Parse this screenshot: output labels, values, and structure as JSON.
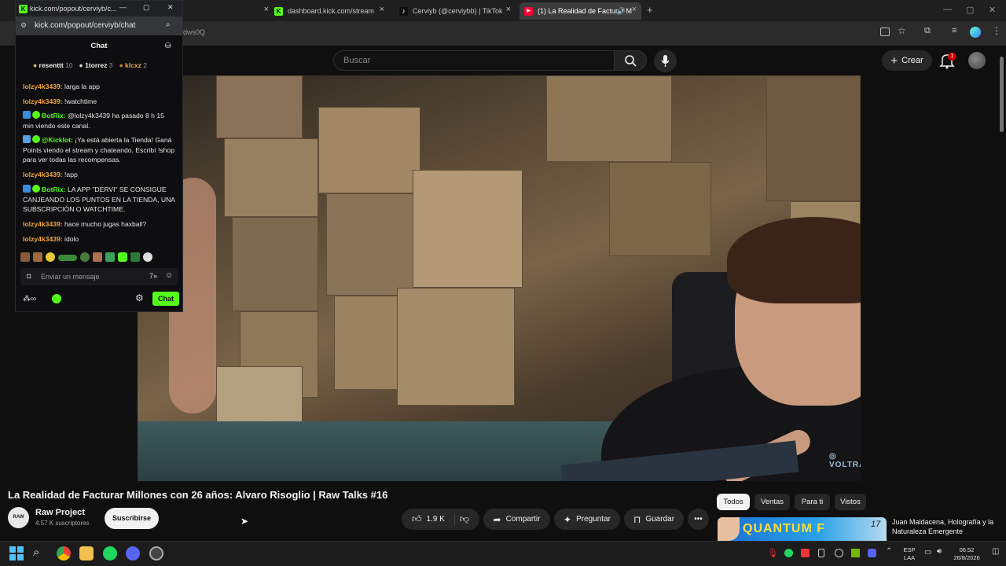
{
  "browser": {
    "tabs": [
      {
        "label": "kick.com/popout/cerviyb/c...",
        "icon": "kick-icon"
      },
      {
        "label": "dashboard.kick.com/stream",
        "icon": "kick-icon"
      },
      {
        "label": "Cerviyb (@cerviybb) | TikTok",
        "icon": "tiktok-icon"
      },
      {
        "label": "(1) La Realidad de Facturar M",
        "icon": "youtube-icon"
      }
    ],
    "new_tab_symbol": "+",
    "address_fragment": "dws0Q"
  },
  "chat_window": {
    "title": "kick.com/popout/cerviyb/c...",
    "url": "kick.com/popout/cerviyb/chat",
    "header": "Chat",
    "leaderboard": [
      {
        "name": "resenttt",
        "count": "10"
      },
      {
        "name": "1torrez",
        "count": "3"
      },
      {
        "name": "klcxz",
        "count": "2"
      }
    ],
    "messages": [
      {
        "user": "lolzy4k3439",
        "text": "larga la app",
        "bot": false
      },
      {
        "user": "lolzy4k3439",
        "text": "!watchtime",
        "bot": false
      },
      {
        "user": "BotRix",
        "text": "@lolzy4k3439 ha pasado 8 h 15 min viendo este canal.",
        "bot": true
      },
      {
        "user": "@Kicklot",
        "text": "¡Ya está abierta la Tienda! Ganá Points viendo el stream y chateando. Escribí !shop para ver todas las recompensas.",
        "bot": true
      },
      {
        "user": "lolzy4k3439",
        "text": "!app",
        "bot": false
      },
      {
        "user": "BotRix",
        "text": "LA APP \"DERVI\" SE CONSIGUE CANJEANDO LOS PUNTOS EN LA TIENDA, UNA SUBSCRIPCIÓN O WATCHTIME.",
        "bot": true
      },
      {
        "user": "lolzy4k3439",
        "text": "hace mucho jugas haxball?",
        "bot": false
      },
      {
        "user": "lolzy4k3439",
        "text": "idolo",
        "bot": false
      }
    ],
    "input_placeholder": "Enviar un mensaje",
    "send_label": "Chat"
  },
  "youtube": {
    "search_placeholder": "Buscar",
    "create_label": "Crear",
    "notif_count": "1",
    "video_title": "La Realidad de Facturar Millones con 26 años: Alvaro Risoglio | Raw Talks #16",
    "channel_name": "Raw Project",
    "channel_avatar_text": "RAW",
    "subscribers": "4.57 K suscriptores",
    "subscribe_label": "Suscribirse",
    "likes": "1.9 K",
    "share_label": "Compartir",
    "ask_label": "Preguntar",
    "save_label": "Guardar",
    "chips": [
      "Todos",
      "Ventas",
      "Para ti",
      "Vistos"
    ],
    "rec_title": "Juan Maldacena, Holografía y la Naturaleza Emergente",
    "rec_thumb_text": "QUANTUM F",
    "rec_thumb_number": "17",
    "video_logo_text": "VOLTRA"
  },
  "taskbar": {
    "lang": "ESP",
    "lang2": "LAA",
    "time": "06:52",
    "date": "26/8/2026"
  }
}
